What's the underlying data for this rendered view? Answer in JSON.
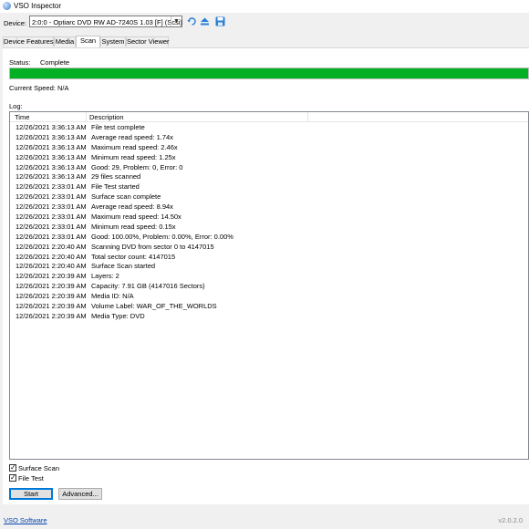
{
  "window": {
    "title": "VSO Inspector"
  },
  "device": {
    "label": "Device:",
    "selected": "2:0:0 - Optiarc DVD RW AD-7240S 1.03 [F] (Scsi)"
  },
  "tabs": [
    "Device Features",
    "Media",
    "Scan",
    "System",
    "Sector Viewer"
  ],
  "active_tab": "Scan",
  "scan": {
    "status_label": "Status:",
    "status_value": "Complete",
    "progress": 1.0,
    "progress_color": "#06b025",
    "speed_label": "Current Speed: N/A",
    "log_label": "Log:"
  },
  "log": {
    "columns": {
      "time": "Time",
      "description": "Description"
    },
    "rows": [
      {
        "time": "12/26/2021 3:36:13 AM",
        "description": "File test complete"
      },
      {
        "time": "12/26/2021 3:36:13 AM",
        "description": "Average read speed: 1.74x"
      },
      {
        "time": "12/26/2021 3:36:13 AM",
        "description": "Maximum read speed: 2.46x"
      },
      {
        "time": "12/26/2021 3:36:13 AM",
        "description": "Minimum read speed: 1.25x"
      },
      {
        "time": "12/26/2021 3:36:13 AM",
        "description": "Good: 29, Problem: 0, Error: 0"
      },
      {
        "time": "12/26/2021 3:36:13 AM",
        "description": "29 files scanned"
      },
      {
        "time": "12/26/2021 2:33:01 AM",
        "description": "File Test started"
      },
      {
        "time": "12/26/2021 2:33:01 AM",
        "description": "Surface scan complete"
      },
      {
        "time": "12/26/2021 2:33:01 AM",
        "description": "Average read speed: 8.94x"
      },
      {
        "time": "12/26/2021 2:33:01 AM",
        "description": "Maximum read speed: 14.50x"
      },
      {
        "time": "12/26/2021 2:33:01 AM",
        "description": "Minimum read speed: 0.15x"
      },
      {
        "time": "12/26/2021 2:33:01 AM",
        "description": "Good: 100.00%, Problem: 0.00%, Error: 0.00%"
      },
      {
        "time": "12/26/2021 2:20:40 AM",
        "description": "Scanning DVD from sector 0 to 4147015"
      },
      {
        "time": "12/26/2021 2:20:40 AM",
        "description": "Total sector count: 4147015"
      },
      {
        "time": "12/26/2021 2:20:40 AM",
        "description": "Surface Scan started"
      },
      {
        "time": "12/26/2021 2:20:39 AM",
        "description": "Layers: 2"
      },
      {
        "time": "12/26/2021 2:20:39 AM",
        "description": "Capacity: 7.91 GB (4147016 Sectors)"
      },
      {
        "time": "12/26/2021 2:20:39 AM",
        "description": "Media ID: N/A"
      },
      {
        "time": "12/26/2021 2:20:39 AM",
        "description": "Volume Label: WAR_OF_THE_WORLDS"
      },
      {
        "time": "12/26/2021 2:20:39 AM",
        "description": "Media Type: DVD"
      }
    ]
  },
  "options": {
    "surface_scan": {
      "label": "Surface Scan",
      "checked": true
    },
    "file_test": {
      "label": "File Test",
      "checked": true
    }
  },
  "buttons": {
    "start": "Start",
    "advanced": "Advanced..."
  },
  "footer": {
    "link": "VSO Software",
    "version": "v2.0.2.0"
  },
  "icons": [
    "app-icon",
    "refresh-icon",
    "eject-icon",
    "save-icon"
  ]
}
